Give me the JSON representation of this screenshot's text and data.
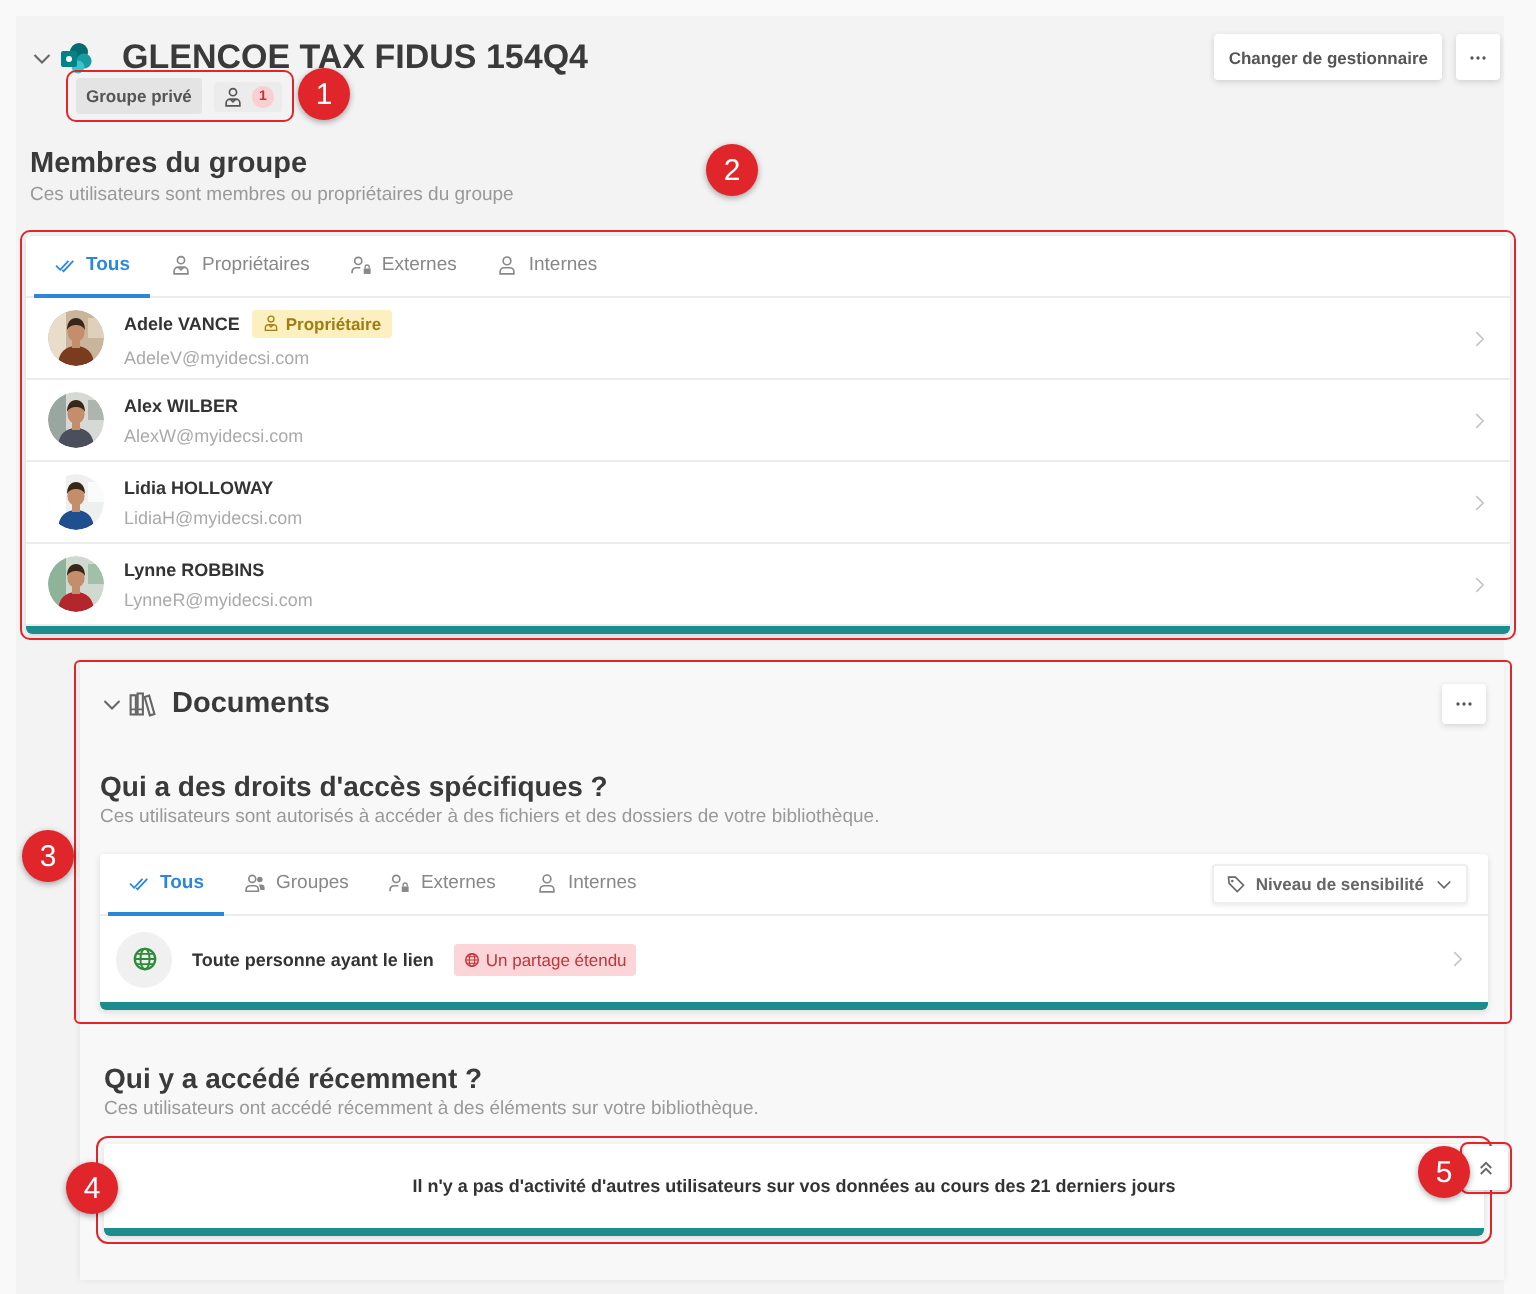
{
  "group": {
    "title": "GLENCOE TAX FIDUS 154Q4",
    "expanded": true,
    "privacy_badge": "Groupe privé",
    "owner_count": "1",
    "change_manager_button": "Changer de gestionnaire",
    "callout": "1"
  },
  "members": {
    "title": "Membres du groupe",
    "subtitle": "Ces utilisateurs sont membres ou propriétaires du groupe",
    "callout": "2",
    "tabs": [
      {
        "kind": "all",
        "label": "Tous",
        "selected": true
      },
      {
        "kind": "owners",
        "label": "Propriétaires",
        "selected": false
      },
      {
        "kind": "external",
        "label": "Externes",
        "selected": false
      },
      {
        "kind": "internal",
        "label": "Internes",
        "selected": false
      }
    ],
    "rows": [
      {
        "name": "Adele VANCE",
        "email": "AdeleV@myidecsi.com",
        "role_badge": "Propriétaire"
      },
      {
        "name": "Alex WILBER",
        "email": "AlexW@myidecsi.com"
      },
      {
        "name": "Lidia HOLLOWAY",
        "email": "LidiaH@myidecsi.com"
      },
      {
        "name": "Lynne ROBBINS",
        "email": "LynneR@myidecsi.com"
      }
    ]
  },
  "documents": {
    "title": "Documents",
    "expanded": true,
    "callout": "3",
    "access": {
      "title": "Qui a des droits d'accès spécifiques ?",
      "subtitle": "Ces utilisateurs sont autorisés à accéder à des fichiers et des dossiers de votre bibliothèque.",
      "tabs": [
        {
          "kind": "all",
          "label": "Tous",
          "selected": true
        },
        {
          "kind": "groups",
          "label": "Groupes",
          "selected": false
        },
        {
          "kind": "external",
          "label": "Externes",
          "selected": false
        },
        {
          "kind": "internal",
          "label": "Internes",
          "selected": false
        }
      ],
      "filter": "Niveau de sensibilité",
      "rows": [
        {
          "name": "Toute personne ayant le lien",
          "badge": "Un partage étendu"
        }
      ]
    }
  },
  "recent": {
    "title": "Qui y a accédé récemment ?",
    "subtitle": "Ces utilisateurs ont accédé récemment à des éléments sur votre bibliothèque.",
    "message": "Il n'y a pas d'activité d'autres utilisateurs sur vos données au cours des 21 derniers jours",
    "callout": "4",
    "collapse_callout": "5"
  }
}
